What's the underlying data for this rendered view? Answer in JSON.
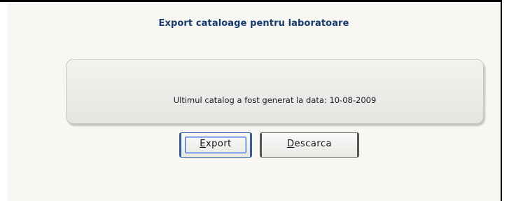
{
  "page": {
    "title": "Export cataloage pentru laboratoare",
    "status_message": "Ultimul catalog a fost generat la data: 10-08-2009"
  },
  "buttons": {
    "export": {
      "label": "Export",
      "accesskey": "E",
      "rest": "xport"
    },
    "download": {
      "label": "Descarca",
      "accesskey": "D",
      "rest": "escarca"
    }
  }
}
